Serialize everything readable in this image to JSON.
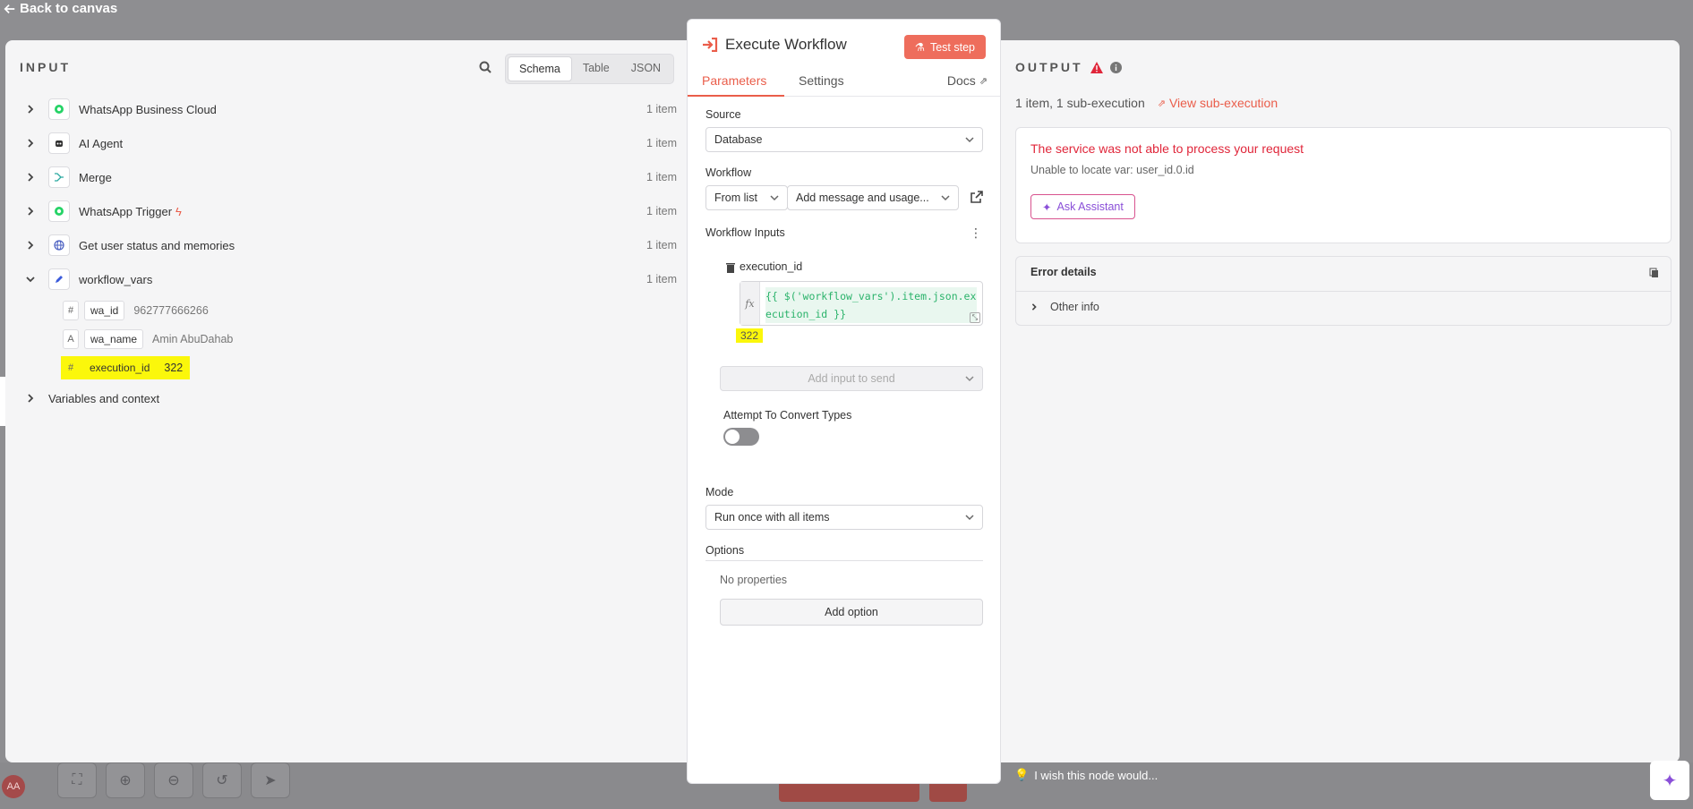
{
  "header": {
    "back_label": "Back to canvas"
  },
  "input": {
    "title": "INPUT",
    "tabs": [
      "Schema",
      "Table",
      "JSON"
    ],
    "nodes": [
      {
        "label": "WhatsApp Business Cloud",
        "count": "1 item"
      },
      {
        "label": "AI Agent",
        "count": "1 item"
      },
      {
        "label": "Merge",
        "count": "1 item"
      },
      {
        "label": "WhatsApp Trigger",
        "count": "1 item"
      },
      {
        "label": "Get user status and memories",
        "count": "1 item"
      },
      {
        "label": "workflow_vars",
        "count": "1 item"
      }
    ],
    "fields": [
      {
        "type": "#",
        "name": "wa_id",
        "value": "962777666266"
      },
      {
        "type": "A",
        "name": "wa_name",
        "value": "Amin AbuDahab"
      },
      {
        "type": "#",
        "name": "execution_id",
        "value": "322"
      }
    ],
    "variables_label": "Variables and context"
  },
  "params": {
    "title": "Execute Workflow",
    "test_button": "Test step",
    "tabs": {
      "parameters": "Parameters",
      "settings": "Settings",
      "docs": "Docs"
    },
    "source_label": "Source",
    "source_value": "Database",
    "workflow_label": "Workflow",
    "workflow_mode": "From list",
    "workflow_value": "Add message and usage...",
    "inputs_label": "Workflow Inputs",
    "input_name": "execution_id",
    "expression": "{{ $('workflow_vars').item.json.execution_id }}",
    "expression_result": "322",
    "add_input_placeholder": "Add input to send",
    "convert_label": "Attempt To Convert Types",
    "mode_label": "Mode",
    "mode_value": "Run once with all items",
    "options_label": "Options",
    "no_properties": "No properties",
    "add_option": "Add option"
  },
  "output": {
    "title": "OUTPUT",
    "summary": "1 item, 1 sub-execution",
    "view_sub": "View sub-execution",
    "error_title": "The service was not able to process your request",
    "error_message": "Unable to locate var: user_id.0.id",
    "assistant_button": "Ask Assistant",
    "details_title": "Error details",
    "other_info": "Other info"
  },
  "footer": {
    "wish": "I wish this node would...",
    "avatar": "AA"
  },
  "colors": {
    "accent": "#ea5d4a",
    "error": "#e0263a",
    "highlight": "#fbf70b",
    "assistant": "#8a4fd8"
  }
}
